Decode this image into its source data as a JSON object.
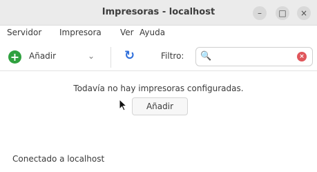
{
  "window": {
    "title": "Impresoras - localhost",
    "controls": {
      "minimize": "–",
      "maximize": "□",
      "close": "×"
    }
  },
  "menubar": {
    "items": [
      {
        "label": "Servidor"
      },
      {
        "label": "Impresora"
      },
      {
        "label": "Ver"
      },
      {
        "label": "Ayuda"
      }
    ]
  },
  "toolbar": {
    "add_icon": "+",
    "add_label": "Añadir",
    "dropdown_icon": "⌄",
    "refresh_icon": "↻",
    "filter_label": "Filtro:",
    "search": {
      "value": "",
      "icon": "🔍",
      "clear_icon": "×"
    }
  },
  "main": {
    "empty_message": "Todavía no hay impresoras configuradas.",
    "add_button_label": "Añadir"
  },
  "statusbar": {
    "text": "Conectado a localhost"
  },
  "colors": {
    "accent_green": "#2fa13f",
    "refresh_blue": "#2f6fdb",
    "clear_red": "#e0565b"
  }
}
